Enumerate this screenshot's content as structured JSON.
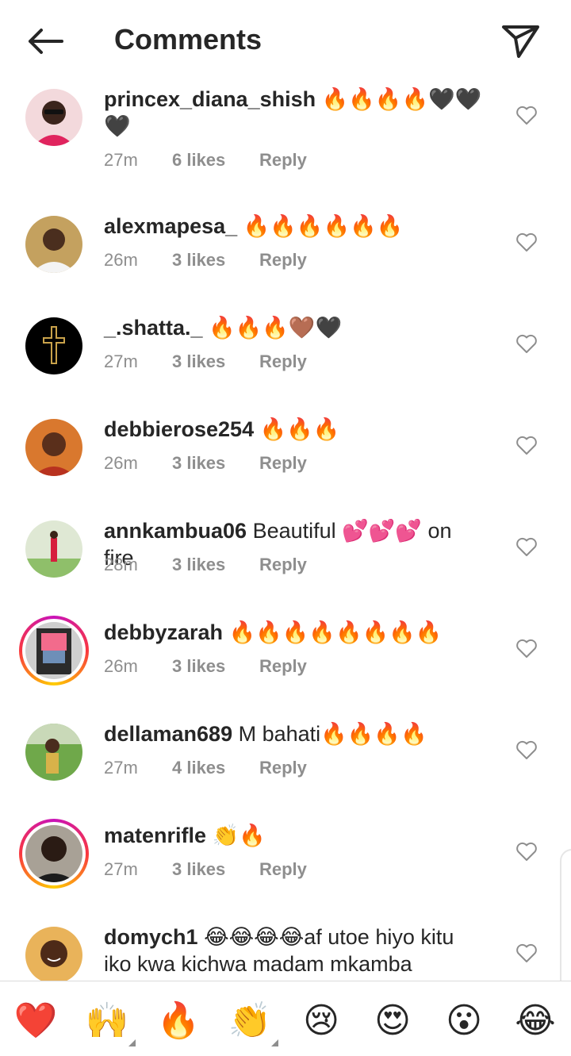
{
  "header": {
    "title": "Comments",
    "back_icon": "arrow-left-icon",
    "send_icon": "paper-plane-icon"
  },
  "comments": [
    {
      "username": "princex_diana_shish",
      "text": "🔥🔥🔥🔥🖤🖤🖤",
      "time": "27m",
      "likes": "6 likes",
      "reply": "Reply",
      "avatar": "woman-sunglasses",
      "story_ring": false
    },
    {
      "username": "alexmapesa_",
      "text": "🔥🔥🔥🔥🔥🔥",
      "time": "26m",
      "likes": "3 likes",
      "reply": "Reply",
      "avatar": "man-white-shirt",
      "story_ring": false
    },
    {
      "username": "_.shatta._",
      "text": "🔥🔥🔥🤎🖤",
      "time": "27m",
      "likes": "3 likes",
      "reply": "Reply",
      "avatar": "cross-black",
      "story_ring": false
    },
    {
      "username": "debbierose254",
      "text": "🔥🔥🔥",
      "time": "26m",
      "likes": "3 likes",
      "reply": "Reply",
      "avatar": "woman-red",
      "story_ring": false
    },
    {
      "username": "annkambua06",
      "text": "Beautiful 💕💕💕 on fire",
      "time": "28m",
      "likes": "3 likes",
      "reply": "Reply",
      "avatar": "woman-outdoor",
      "story_ring": false
    },
    {
      "username": "debbyzarah",
      "text": "🔥🔥🔥🔥🔥🔥🔥🔥",
      "time": "26m",
      "likes": "3 likes",
      "reply": "Reply",
      "avatar": "woman-pink-top",
      "story_ring": true
    },
    {
      "username": "dellaman689",
      "text": "M bahati🔥🔥🔥🔥",
      "time": "27m",
      "likes": "4 likes",
      "reply": "Reply",
      "avatar": "man-field",
      "story_ring": false
    },
    {
      "username": "matenrifle",
      "text": "👏🔥",
      "time": "27m",
      "likes": "3 likes",
      "reply": "Reply",
      "avatar": "man-dark",
      "story_ring": true
    },
    {
      "username": "domych1",
      "text": "😂😂😂😂af utoe hiyo kitu iko kwa kichwa madam mkamba",
      "time": "",
      "likes": "",
      "reply": "",
      "avatar": "man-smiling",
      "story_ring": false
    }
  ],
  "like_icon": "heart-outline-icon",
  "emoji_bar": [
    {
      "emoji": "❤️",
      "name": "red-heart"
    },
    {
      "emoji": "🙌",
      "name": "raising-hands"
    },
    {
      "emoji": "🔥",
      "name": "fire"
    },
    {
      "emoji": "👏",
      "name": "clapping-hands"
    },
    {
      "emoji": "😢",
      "name": "crying-face"
    },
    {
      "emoji": "😍",
      "name": "heart-eyes"
    },
    {
      "emoji": "😮",
      "name": "surprised-face"
    },
    {
      "emoji": "😂",
      "name": "tears-of-joy"
    }
  ],
  "colors": {
    "text": "#262626",
    "secondary": "#8e8e8e",
    "divider": "#dbdbdb",
    "ring_start": "#c913b9",
    "ring_end": "#fecd00"
  }
}
